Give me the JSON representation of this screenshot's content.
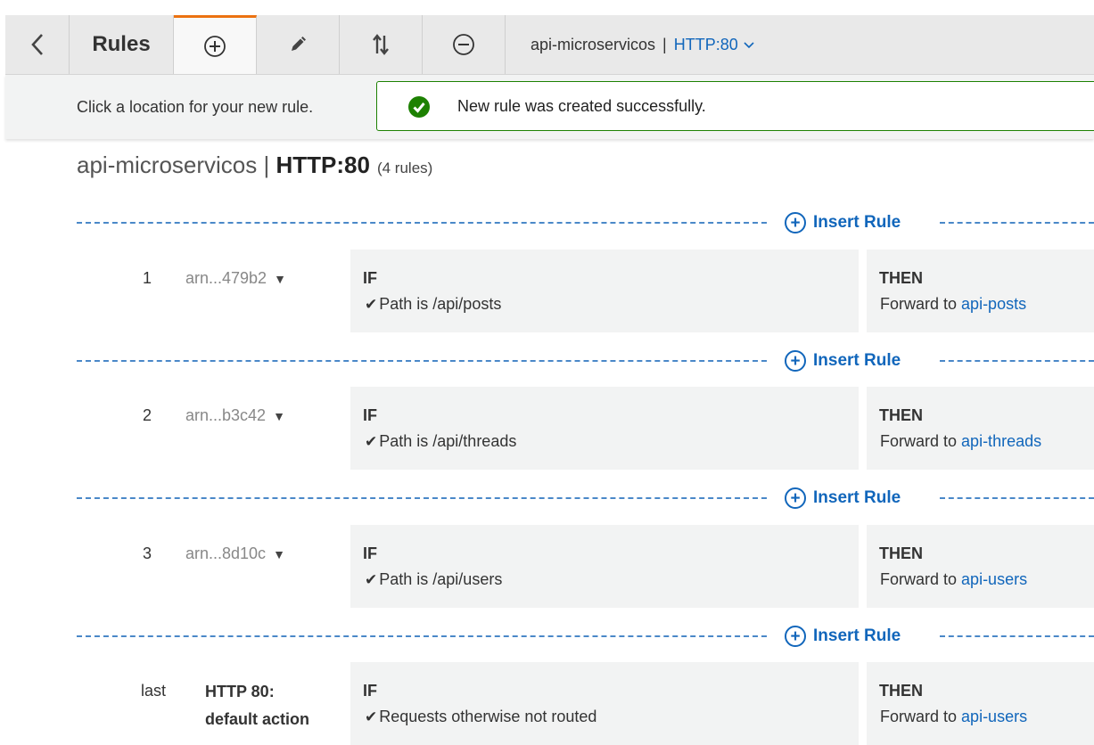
{
  "toolbar": {
    "title": "Rules",
    "listener_name": "api-microservicos",
    "listener_separator": "|",
    "listener_protocol": "HTTP:80"
  },
  "subbar": {
    "hint": "Click a location for your new rule.",
    "success_message": "New rule was created successfully."
  },
  "heading": {
    "name": "api-microservicos",
    "separator": "|",
    "protocol": "HTTP:80",
    "count": "(4 rules)"
  },
  "insert_label": "Insert Rule",
  "rules": [
    {
      "num": "1",
      "arn": "arn...479b2",
      "if_label": "IF",
      "condition": "Path is /api/posts",
      "then_label": "THEN",
      "action": "Forward to",
      "target": "api-posts"
    },
    {
      "num": "2",
      "arn": "arn...b3c42",
      "if_label": "IF",
      "condition": "Path is /api/threads",
      "then_label": "THEN",
      "action": "Forward to",
      "target": "api-threads"
    },
    {
      "num": "3",
      "arn": "arn...8d10c",
      "if_label": "IF",
      "condition": "Path is /api/users",
      "then_label": "THEN",
      "action": "Forward to",
      "target": "api-users"
    },
    {
      "num": "last",
      "default_label_1": "HTTP 80:",
      "default_label_2": "default action",
      "if_label": "IF",
      "condition": "Requests otherwise not routed",
      "then_label": "THEN",
      "action": "Forward to",
      "target": "api-users"
    }
  ],
  "colors": {
    "accent": "#ec7211",
    "link": "#1166bb",
    "success": "#1d8102"
  }
}
